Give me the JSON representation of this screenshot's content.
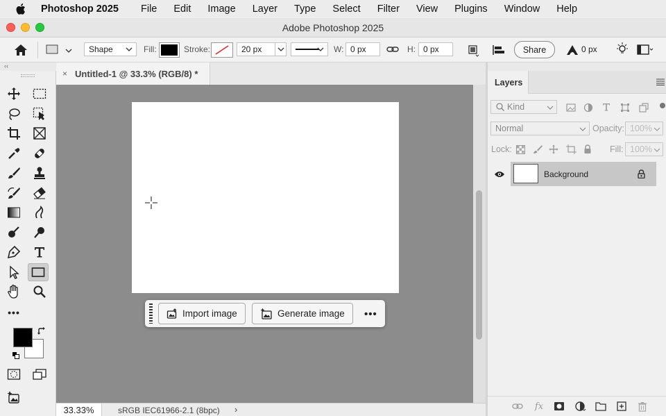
{
  "menubar": {
    "app_name": "Photoshop 2025",
    "items": [
      "File",
      "Edit",
      "Image",
      "Layer",
      "Type",
      "Select",
      "Filter",
      "View",
      "Plugins",
      "Window",
      "Help"
    ]
  },
  "window": {
    "title": "Adobe Photoshop 2025"
  },
  "options_bar": {
    "tool_mode": "Shape",
    "fill_label": "Fill:",
    "fill_color": "#000000",
    "stroke_label": "Stroke:",
    "stroke_width": "20 px",
    "w_label": "W:",
    "w_value": "0 px",
    "h_label": "H:",
    "h_value": "0 px",
    "share_label": "Share",
    "feather_value": "0 px"
  },
  "document": {
    "tab_title": "Untitled-1 @ 33.3% (RGB/8) *",
    "close_glyph": "×"
  },
  "status_bar": {
    "zoom": "33.33%",
    "color_profile": "sRGB IEC61966-2.1 (8bpc)",
    "arrow": "›"
  },
  "taskbar": {
    "import_label": "Import image",
    "generate_label": "Generate image",
    "more_label": "•••"
  },
  "toolbar": {
    "more_label": "•••",
    "foreground_color": "#000000",
    "background_color": "#ffffff"
  },
  "layers_panel": {
    "tab_label": "Layers",
    "kind_placeholder": "Kind",
    "blend_mode": "Normal",
    "opacity_label": "Opacity:",
    "opacity_value": "100%",
    "lock_label": "Lock:",
    "fill_label": "Fill:",
    "fill_value": "100%",
    "layers": [
      {
        "name": "Background",
        "visible": true,
        "locked": true
      }
    ]
  }
}
